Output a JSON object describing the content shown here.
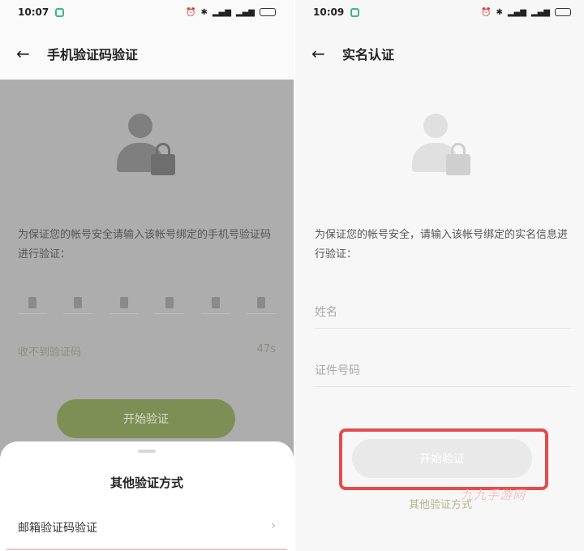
{
  "left_screen": {
    "status": {
      "time": "10:07"
    },
    "nav": {
      "back_icon": "←",
      "title": "手机验证码验证"
    },
    "description": "为保证您的帐号安全请输入该帐号绑定的手机号验证码进行验证：",
    "code_digits": 6,
    "resend_label": "收不到验证码",
    "countdown": "47s",
    "start_button": "开始验证",
    "sheet": {
      "title": "其他验证方式",
      "option": "邮箱验证码验证",
      "chevron": "›"
    }
  },
  "right_screen": {
    "status": {
      "time": "10:09"
    },
    "nav": {
      "back_icon": "←",
      "title": "实名认证"
    },
    "description": "为保证您的帐号安全，请输入该帐号绑定的实名信息进行验证：",
    "name_placeholder": "姓名",
    "id_placeholder": "证件号码",
    "start_button": "开始验证",
    "other_methods": "其他验证方式"
  },
  "watermark": "九九手游网",
  "colors": {
    "accent_green": "#7d8f55",
    "highlight_red": "#e44c4c",
    "app_icon_green": "#3cb58e"
  }
}
